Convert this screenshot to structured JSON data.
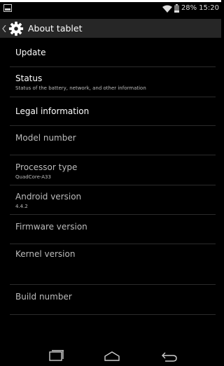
{
  "status_bar": {
    "battery": "28%",
    "time": "15:20",
    "icons": [
      "screenshot-icon",
      "wifi-icon",
      "battery-icon"
    ]
  },
  "action_bar": {
    "title": "About tablet",
    "icons": [
      "back-chevron-icon",
      "settings-gear-icon"
    ]
  },
  "items": [
    {
      "title": "Update",
      "subtitle": ""
    },
    {
      "title": "Status",
      "subtitle": "Status of the battery, network, and other information"
    },
    {
      "title": "Legal information",
      "subtitle": ""
    },
    {
      "title": "Model number",
      "subtitle": ""
    },
    {
      "title": "Processor type",
      "subtitle": "QuadCore-A33"
    },
    {
      "title": "Android version",
      "subtitle": "4.4.2"
    },
    {
      "title": "Firmware version",
      "subtitle": ""
    },
    {
      "title": "Kernel version",
      "subtitle": ""
    },
    {
      "title": "Build number",
      "subtitle": ""
    }
  ],
  "nav_bar": {
    "icons": [
      "recent-apps-icon",
      "home-icon",
      "back-icon"
    ]
  }
}
